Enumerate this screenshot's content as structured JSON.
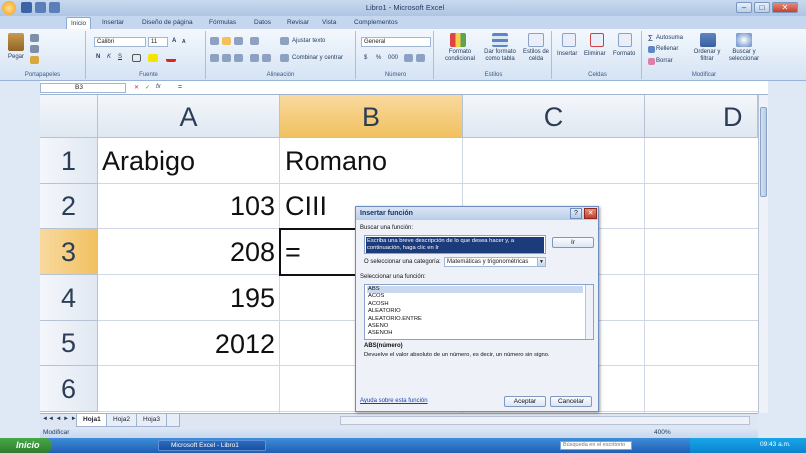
{
  "title_bar": {
    "title": "Libro1 - Microsoft Excel",
    "minimize": "–",
    "maximize": "□",
    "close": "✕"
  },
  "tabs": [
    "Inicio",
    "Insertar",
    "Diseño de página",
    "Fórmulas",
    "Datos",
    "Revisar",
    "Vista",
    "Complementos"
  ],
  "ribbon": {
    "clipboard": {
      "paste": "Pegar",
      "group": "Portapapeles"
    },
    "font": {
      "name": "Calibri",
      "size": "11",
      "group": "Fuente"
    },
    "alignment": {
      "wrap": "Ajustar texto",
      "merge": "Combinar y centrar",
      "group": "Alineación"
    },
    "number": {
      "format": "General",
      "group": "Número"
    },
    "styles": {
      "conditional": "Formato condicional",
      "table": "Dar formato como tabla",
      "cell_styles": "Estilos de celda",
      "group": "Estilos"
    },
    "cells": {
      "insert": "Insertar",
      "delete": "Eliminar",
      "format": "Formato",
      "group": "Celdas"
    },
    "editing": {
      "autosum": "Autosuma",
      "fill": "Rellenar",
      "clear": "Borrar",
      "sort": "Ordenar y filtrar",
      "find": "Buscar y seleccionar",
      "group": "Modificar"
    }
  },
  "formula_bar": {
    "name_box": "B3",
    "fx": "fx",
    "content": "="
  },
  "columns": [
    "A",
    "B",
    "C",
    "D"
  ],
  "rows": [
    "1",
    "2",
    "3",
    "4",
    "5",
    "6"
  ],
  "cells": {
    "a1": "Arabigo",
    "b1": "Romano",
    "a2": "103",
    "b2": "CIII",
    "a3": "208",
    "b3": "=",
    "a4": "195",
    "a5": "2012"
  },
  "sheets": [
    "Hoja1",
    "Hoja2",
    "Hoja3"
  ],
  "status": {
    "mode": "Modificar",
    "zoom": "400%"
  },
  "dialog": {
    "title": "Insertar función",
    "search_label": "Buscar una función:",
    "search_text": "Escriba una breve descripción de lo que desea hacer y, a continuación, haga clic en Ir",
    "go_button": "Ir",
    "category_label": "O seleccionar una categoría:",
    "category_value": "Matemáticas y trigonométricas",
    "select_label": "Seleccionar una función:",
    "functions": [
      "ABS",
      "ACOS",
      "ACOSH",
      "ALEATORIO",
      "ALEATORIO.ENTRE",
      "ASENO",
      "ASENOH"
    ],
    "selected_signature": "ABS(número)",
    "description": "Devuelve el valor absoluto de un número, es decir, un número sin signo.",
    "help_link": "Ayuda sobre esta función",
    "ok": "Aceptar",
    "cancel": "Cancelar"
  },
  "taskbar": {
    "start": "Inicio",
    "task": "Microsoft Excel - Libro1",
    "search": "Búsqueda en el escritorio",
    "clock": "09:43 a.m."
  }
}
